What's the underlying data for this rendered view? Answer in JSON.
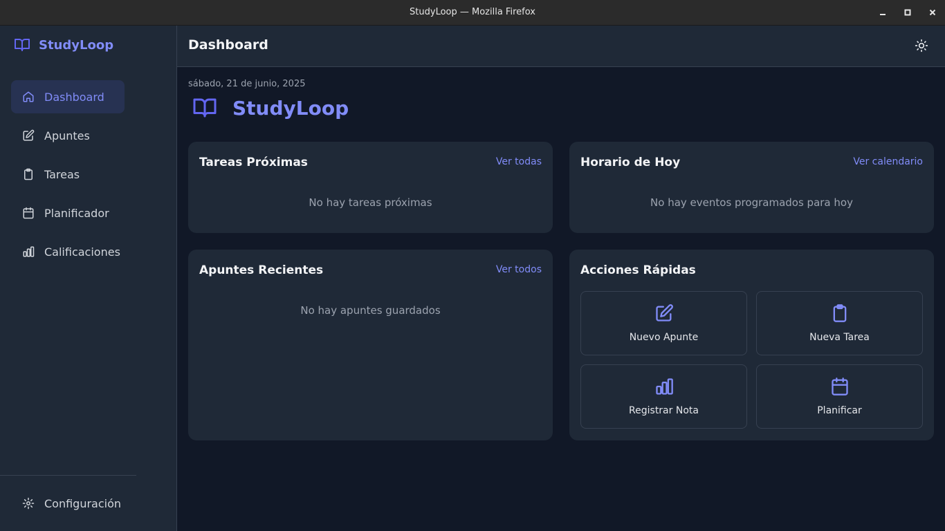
{
  "window": {
    "title": "StudyLoop — Mozilla Firefox"
  },
  "sidebar": {
    "brand": "StudyLoop",
    "items": [
      {
        "label": "Dashboard",
        "icon": "home-icon",
        "active": true
      },
      {
        "label": "Apuntes",
        "icon": "edit-icon"
      },
      {
        "label": "Tareas",
        "icon": "clipboard-icon"
      },
      {
        "label": "Planificador",
        "icon": "calendar-icon"
      },
      {
        "label": "Calificaciones",
        "icon": "bar-chart-icon"
      }
    ],
    "settings": "Configuración"
  },
  "header": {
    "title": "Dashboard",
    "theme_icon": "sun-icon"
  },
  "main": {
    "date": "sábado, 21 de junio, 2025",
    "hero": "StudyLoop",
    "cards": {
      "tasks": {
        "title": "Tareas Próximas",
        "link": "Ver todas",
        "empty": "No hay tareas próximas"
      },
      "schedule": {
        "title": "Horario de Hoy",
        "link": "Ver calendario",
        "empty": "No hay eventos programados para hoy"
      },
      "notes": {
        "title": "Apuntes Recientes",
        "link": "Ver todos",
        "empty": "No hay apuntes guardados"
      },
      "actions": {
        "title": "Acciones Rápidas",
        "items": [
          {
            "label": "Nuevo Apunte",
            "icon": "edit-icon"
          },
          {
            "label": "Nueva Tarea",
            "icon": "clipboard-icon"
          },
          {
            "label": "Registrar Nota",
            "icon": "bar-chart-icon"
          },
          {
            "label": "Planificar",
            "icon": "calendar-icon"
          }
        ]
      }
    }
  },
  "colors": {
    "accent": "#818cf8",
    "brand_icon": "#6366f1",
    "bg": "#111827",
    "panel": "#1f2937"
  }
}
